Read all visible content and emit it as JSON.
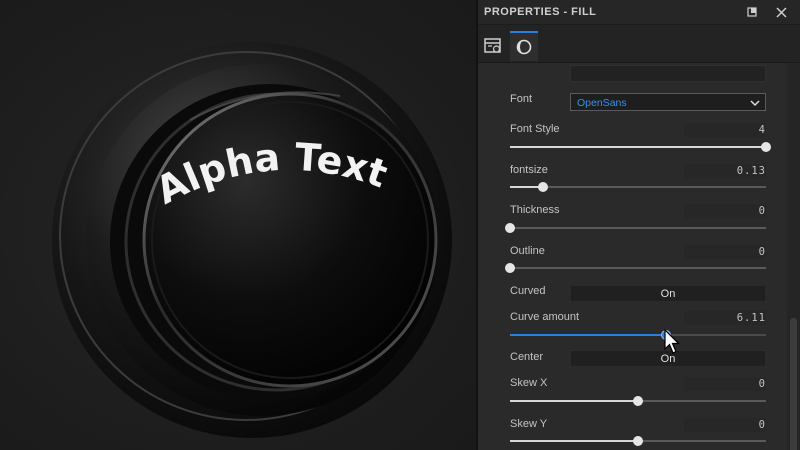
{
  "panel": {
    "title": "PROPERTIES - FILL",
    "tabs": [
      {
        "icon": "layout-settings-icon",
        "active": false
      },
      {
        "icon": "material-sphere-icon",
        "active": true
      }
    ]
  },
  "viewport": {
    "model_text": "Alpha Text"
  },
  "properties": {
    "font": {
      "label": "Font",
      "value": "OpenSans"
    },
    "font_style": {
      "label": "Font Style",
      "value": "4",
      "fraction": 1.0
    },
    "fontsize": {
      "label": "fontsize",
      "value": "0.13",
      "fraction": 0.13
    },
    "thickness": {
      "label": "Thickness",
      "value": "0",
      "fraction": 0.0
    },
    "outline": {
      "label": "Outline",
      "value": "0",
      "fraction": 0.0
    },
    "curved": {
      "label": "Curved",
      "value": "On"
    },
    "curve_amount": {
      "label": "Curve amount",
      "value": "6.11",
      "fraction": 0.61
    },
    "center": {
      "label": "Center",
      "value": "On"
    },
    "skew_x": {
      "label": "Skew X",
      "value": "0",
      "fraction": 0.5
    },
    "skew_y": {
      "label": "Skew Y",
      "value": "0",
      "fraction": 0.5
    }
  },
  "colors": {
    "accent": "#2b7de0",
    "panel_bg": "#2a2a2a",
    "font_value": "#3d8fe8"
  }
}
